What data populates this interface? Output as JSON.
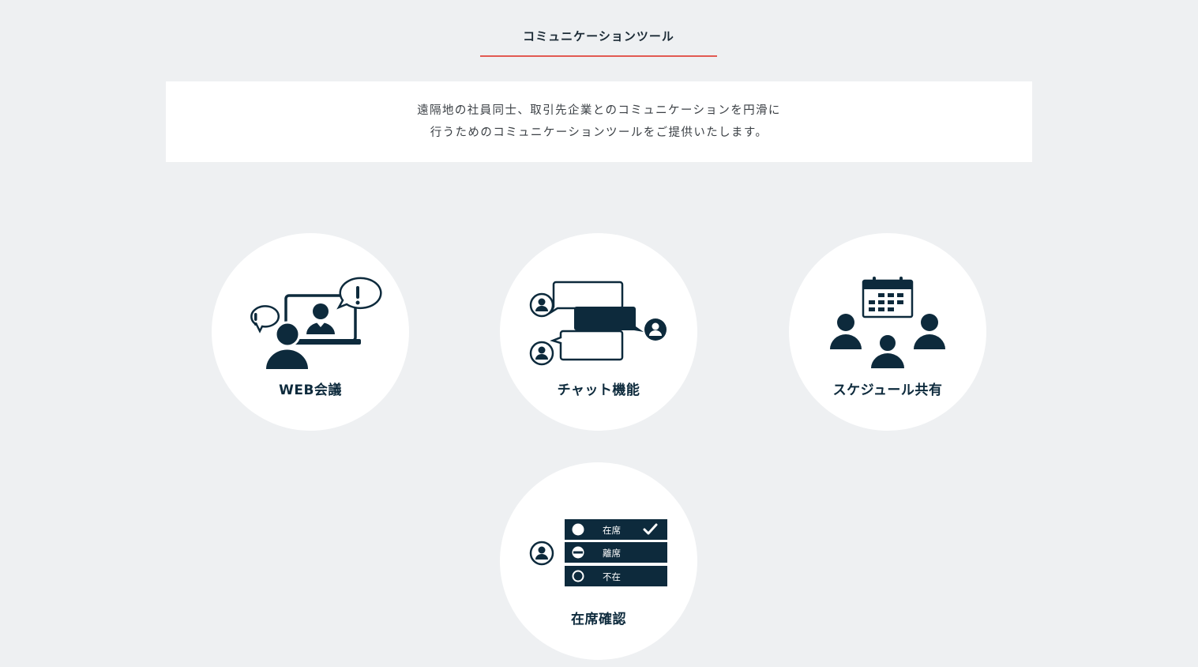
{
  "section": {
    "title": "コミュニケーションツール",
    "accent_color": "#e25a52"
  },
  "intro": {
    "line1": "遠隔地の社員同士、取引先企業とのコミュニケーションを円滑に",
    "line2": "行うためのコミュニケーションツールをご提供いたします。"
  },
  "features": [
    {
      "label": "WEB会議",
      "icon": "web-meeting-icon"
    },
    {
      "label": "チャット機能",
      "icon": "chat-icon"
    },
    {
      "label": "スケジュール共有",
      "icon": "schedule-share-icon"
    },
    {
      "label": "在席確認",
      "icon": "presence-check-icon",
      "statuses": [
        "在席",
        "離席",
        "不在"
      ]
    }
  ],
  "colors": {
    "icon_navy": "#0d2a3c",
    "background": "#eef0f2"
  }
}
